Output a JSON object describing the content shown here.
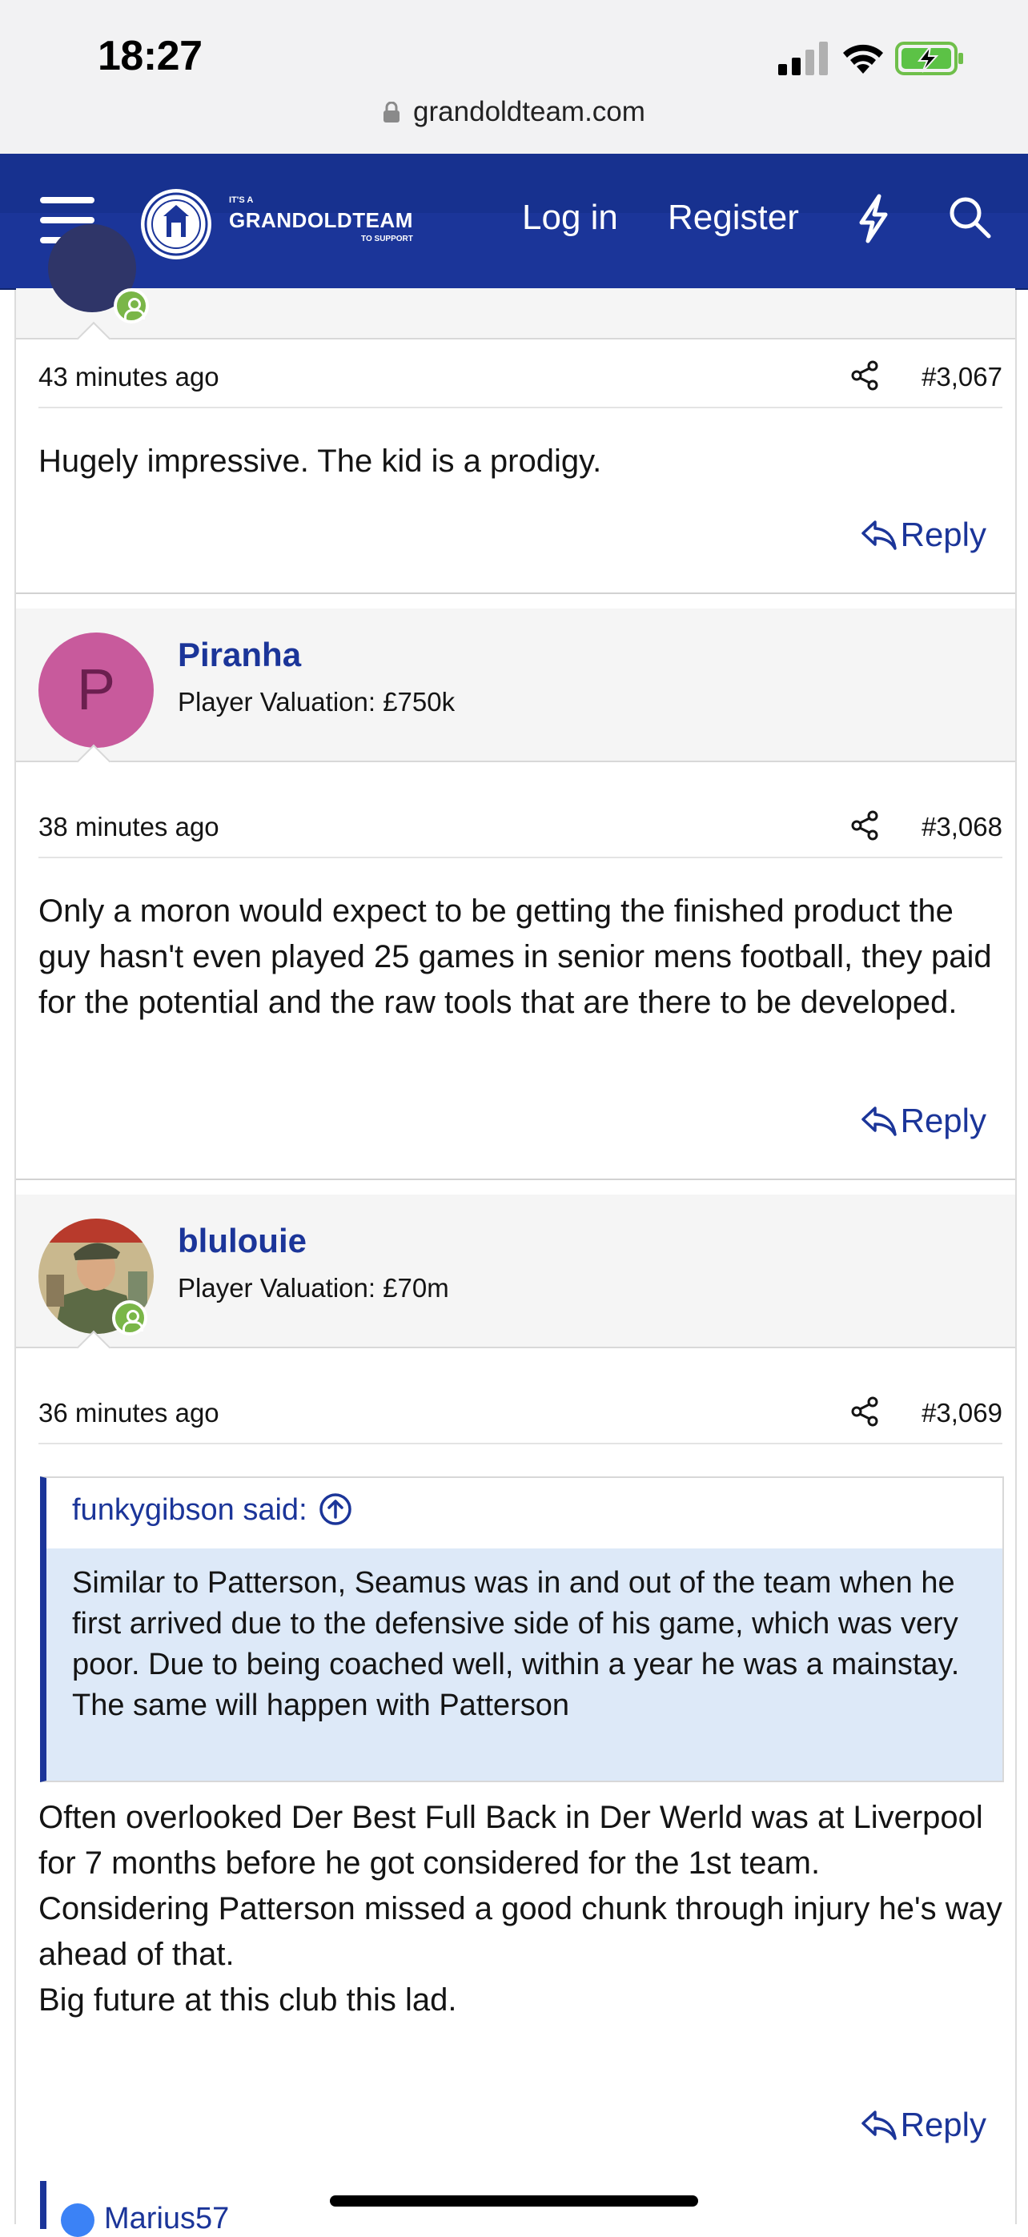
{
  "status_bar": {
    "time": "18:27",
    "url": "grandoldteam.com"
  },
  "header": {
    "logo_small": "IT'S A",
    "logo_big": "GRANDOLDTEAM",
    "logo_tiny": "TO SUPPORT",
    "login_label": "Log in",
    "register_label": "Register"
  },
  "posts": [
    {
      "time_ago": "43 minutes ago",
      "post_number": "#3,067",
      "body": "Hugely impressive. The kid is a prodigy.",
      "reply_label": "Reply"
    },
    {
      "username": "Piranha",
      "avatar_letter": "P",
      "avatar_color": "#c85a9c",
      "valuation": "Player Valuation: £750k",
      "time_ago": "38 minutes ago",
      "post_number": "#3,068",
      "body": "Only a moron would expect to be getting the finished product the guy hasn't even played 25 games in senior mens football, they paid for the potential and the raw tools that are there to be developed.",
      "reply_label": "Reply"
    },
    {
      "username": "blulouie",
      "valuation": "Player Valuation: £70m",
      "time_ago": "36 minutes ago",
      "post_number": "#3,069",
      "quote_author": "funkygibson said:",
      "quote_text": "Similar to Patterson, Seamus was in and out of the team when he first arrived due to the defensive side of his game, which was very poor. Due to being coached well, within a year he was a mainstay. The same will happen with Patterson",
      "body_lines": [
        "Often overlooked Der Best Full Back in Der Werld was at Liverpool for 7 months before he got considered for the 1st team.",
        "Considering Patterson missed a good chunk through injury he's way ahead of that.",
        "Big future at this club this lad."
      ],
      "reply_label": "Reply"
    }
  ],
  "next_quote_author": "Marius57",
  "colors": {
    "brand": "#1b3599",
    "online": "#7ab648",
    "quote_bg": "#dde9f8"
  }
}
